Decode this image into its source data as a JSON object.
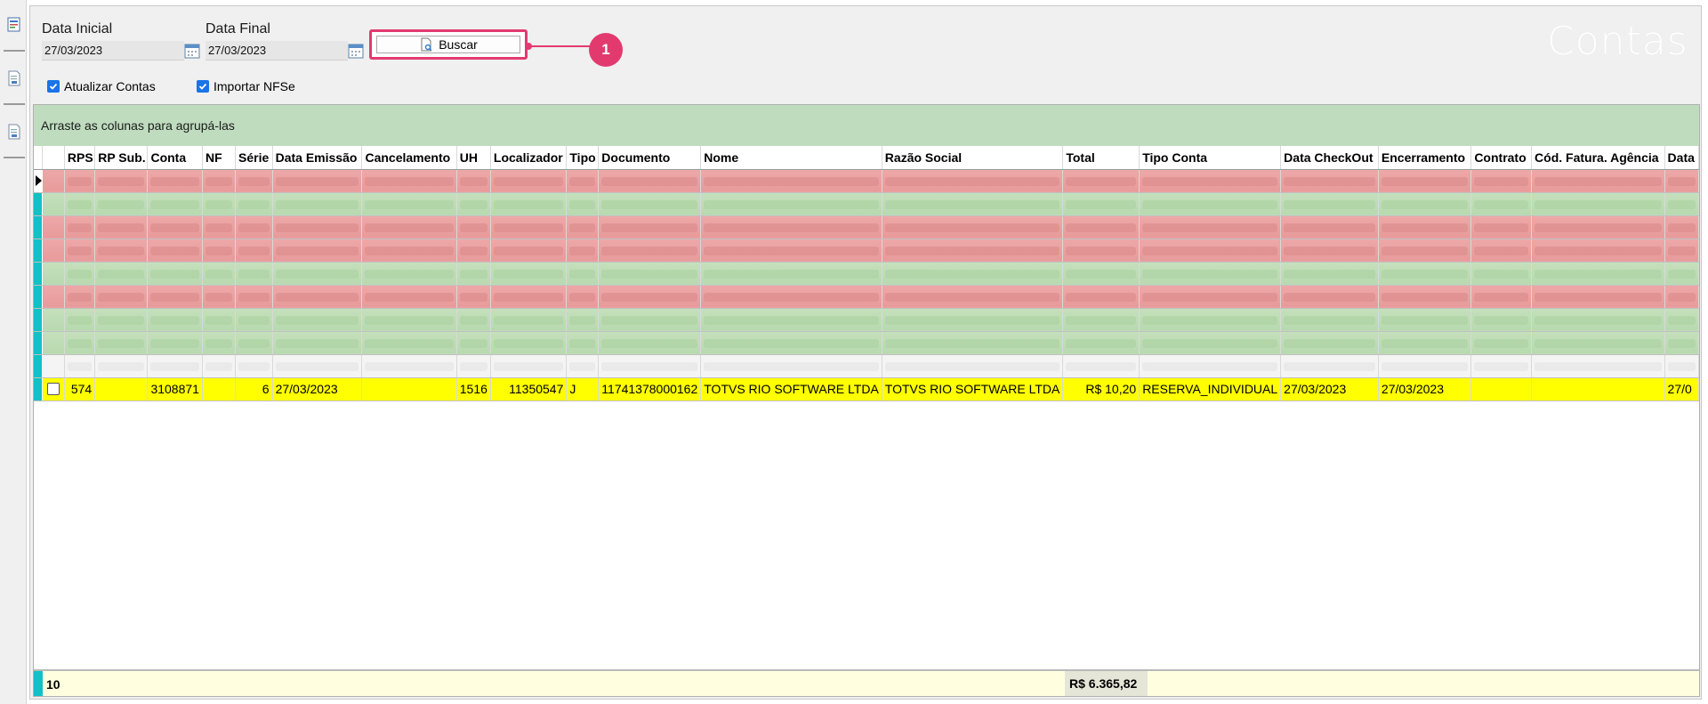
{
  "watermark": "Contas",
  "filters": {
    "data_inicial_label": "Data Inicial",
    "data_inicial_value": "27/03/2023",
    "data_final_label": "Data Final",
    "data_final_value": "27/03/2023",
    "buscar_label": "Buscar",
    "badge": "1"
  },
  "options": {
    "atualizar_contas": "Atualizar Contas",
    "importar_nfse": "Importar NFSe"
  },
  "grid": {
    "group_hint": "Arraste as colunas para agrupá-las",
    "columns": [
      "RPS",
      "RP Sub.",
      "Conta",
      "NF",
      "Série",
      "Data Emissão",
      "Cancelamento",
      "UH",
      "Localizador",
      "Tipo",
      "Documento",
      "Nome",
      "Razão Social",
      "Total",
      "Tipo Conta",
      "Data CheckOut",
      "Encerramento",
      "Contrato",
      "Cód. Fatura. Agência",
      "Data"
    ],
    "visible_row": {
      "rps": "574",
      "rp_sub": "",
      "conta": "3108871",
      "nf": "",
      "serie": "6",
      "data_emissao": "27/03/2023",
      "cancelamento": "",
      "uh": "1516",
      "localizador": "11350547",
      "tipo": "J",
      "documento": "11741378000162",
      "nome": "TOTVS RIO SOFTWARE LTDA",
      "razao_social": "TOTVS RIO SOFTWARE LTDA",
      "total": "R$ 10,20",
      "tipo_conta": "RESERVA_INDIVIDUAL",
      "data_checkout": "27/03/2023",
      "encerramento": "27/03/2023",
      "contrato": "",
      "cod_fatura": "",
      "data": "27/0"
    },
    "footer": {
      "count": "10",
      "total": "R$ 6.365,82"
    }
  }
}
